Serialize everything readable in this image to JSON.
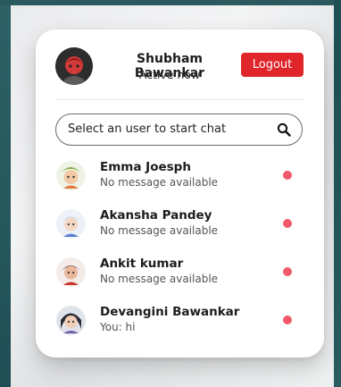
{
  "colors": {
    "accent": "#e0262b",
    "status_dot": "#f05a6b"
  },
  "header": {
    "user_name": "Shubham Bawankar",
    "status": "Active now",
    "logout_label": "Logout",
    "avatar_icon": "user-avatar-icon"
  },
  "search": {
    "label": "Select an user to start chat",
    "icon": "search-icon"
  },
  "chats": [
    {
      "name": "Emma Joesph",
      "message": "No message available",
      "avatar": "avatar-emma-icon"
    },
    {
      "name": "Akansha Pandey",
      "message": "No message available",
      "avatar": "avatar-akansha-icon"
    },
    {
      "name": "Ankit kumar",
      "message": "No message available",
      "avatar": "avatar-ankit-icon"
    },
    {
      "name": "Devangini Bawankar",
      "message": "You: hi",
      "avatar": "avatar-devangini-icon"
    }
  ]
}
